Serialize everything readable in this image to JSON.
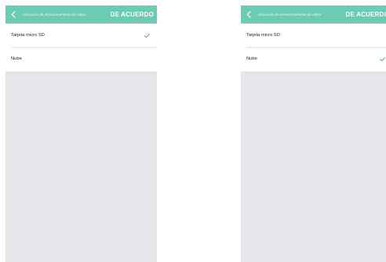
{
  "colors": {
    "header_bg": "#6ccbb3",
    "check": "#3b8ad9",
    "panel_bg": "#e6e5ea"
  },
  "screens": [
    {
      "header": {
        "back_icon": "chevron-left-icon",
        "title": "Ubicación de almacenamiento de video",
        "ok_label": "DE ACUERDO"
      },
      "options": [
        {
          "label": "Tarjeta micro SD",
          "selected": true
        },
        {
          "label": "Nube",
          "selected": false
        }
      ]
    },
    {
      "header": {
        "back_icon": "chevron-left-icon",
        "title": "Ubicación de almacenamiento de video",
        "ok_label": "DE ACUERDO"
      },
      "options": [
        {
          "label": "Tarjeta micro SD",
          "selected": false
        },
        {
          "label": "Nube",
          "selected": true
        }
      ]
    }
  ]
}
